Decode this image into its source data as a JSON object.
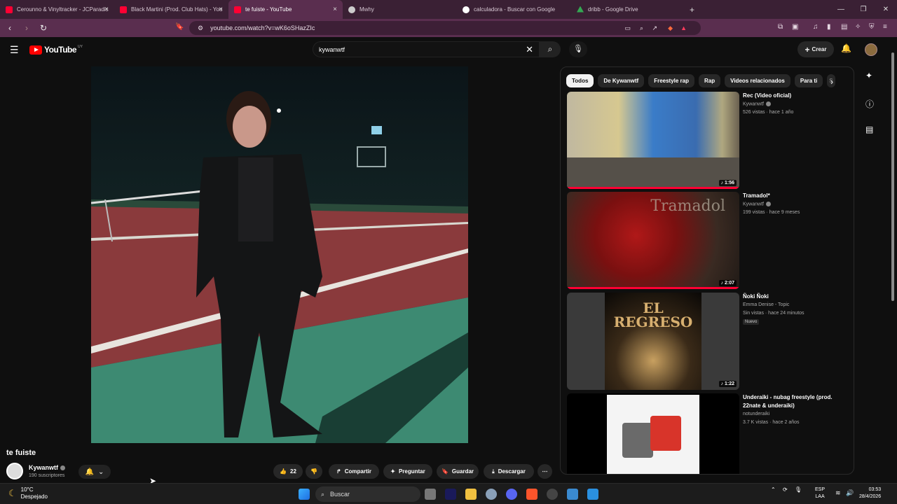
{
  "browser": {
    "tabs": [
      {
        "label": "Cerounno & Vinyltracker - JCParadis",
        "favicon": "youtube-favicon",
        "color": "#ff0033"
      },
      {
        "label": "Black Martini (Prod. Club Hats) - You",
        "favicon": "youtube-favicon",
        "color": "#ff0033"
      },
      {
        "label": "te fuiste - YouTube",
        "favicon": "youtube-favicon",
        "color": "#ff0033",
        "active": true
      },
      {
        "label": "Mwhy",
        "favicon": "globe-favicon",
        "color": "#cccccc"
      },
      {
        "label": "calculadora - Buscar con Google",
        "favicon": "google-favicon",
        "color": "#ffffff"
      },
      {
        "label": "dribb - Google Drive",
        "favicon": "drive-favicon",
        "color": "#34a853"
      }
    ],
    "new_tab": "+",
    "url": "youtube.com/watch?v=wK6oSHazZIc"
  },
  "youtube": {
    "logo": "YouTube",
    "country_code": "UY",
    "search_query": "kywanwtf",
    "create_label": "Crear"
  },
  "video": {
    "title": "te fuiste",
    "channel": "Kywanwtf",
    "subscribers": "190 suscriptores",
    "likes": "22",
    "share_label": "Compartir",
    "ask_label": "Preguntar",
    "save_label": "Guardar",
    "download_label": "Descargar"
  },
  "sidebar": {
    "chips": [
      "Todos",
      "De Kywanwtf",
      "Freestyle rap",
      "Rap",
      "Videos relacionados",
      "Para ti",
      "S"
    ],
    "cards": [
      {
        "title": "Rec (Video oficial)",
        "channel": "Kywanwtf",
        "meta": "526 vistas · hace 1 año",
        "duration": "♪ 1:56",
        "progress": 1.0
      },
      {
        "title": "Tramadol*",
        "channel": "Kywanwtf",
        "meta": "199 vistas · hace 9 meses",
        "duration": "♪ 2:07",
        "progress": 1.0
      },
      {
        "title": "Ñoki Ñoki",
        "channel": "Emma Denise - Topic",
        "meta": "Sin vistas · hace 24 minutos",
        "badge": "Nuevo",
        "duration": "♪ 1:22",
        "thumb_text": "EL REGRESO"
      },
      {
        "title": "Underaiki - nubag freestyle (prod. 22nate & underaiki)",
        "channel": "notunderaiki",
        "meta": "3.7 K vistas · hace 2 años"
      }
    ],
    "thumb2_text": "Tramadol"
  },
  "taskbar": {
    "temperature": "10°C",
    "weather": "Despejado",
    "search_label": "Buscar",
    "lang_line1": "ESP",
    "lang_line2": "LAA",
    "time": "03:53",
    "date": "28/4/2026"
  },
  "colors": {
    "accent": "#ff0033",
    "browser_frame": "#3a2034",
    "browser_toolbar": "#5a2e4f"
  }
}
